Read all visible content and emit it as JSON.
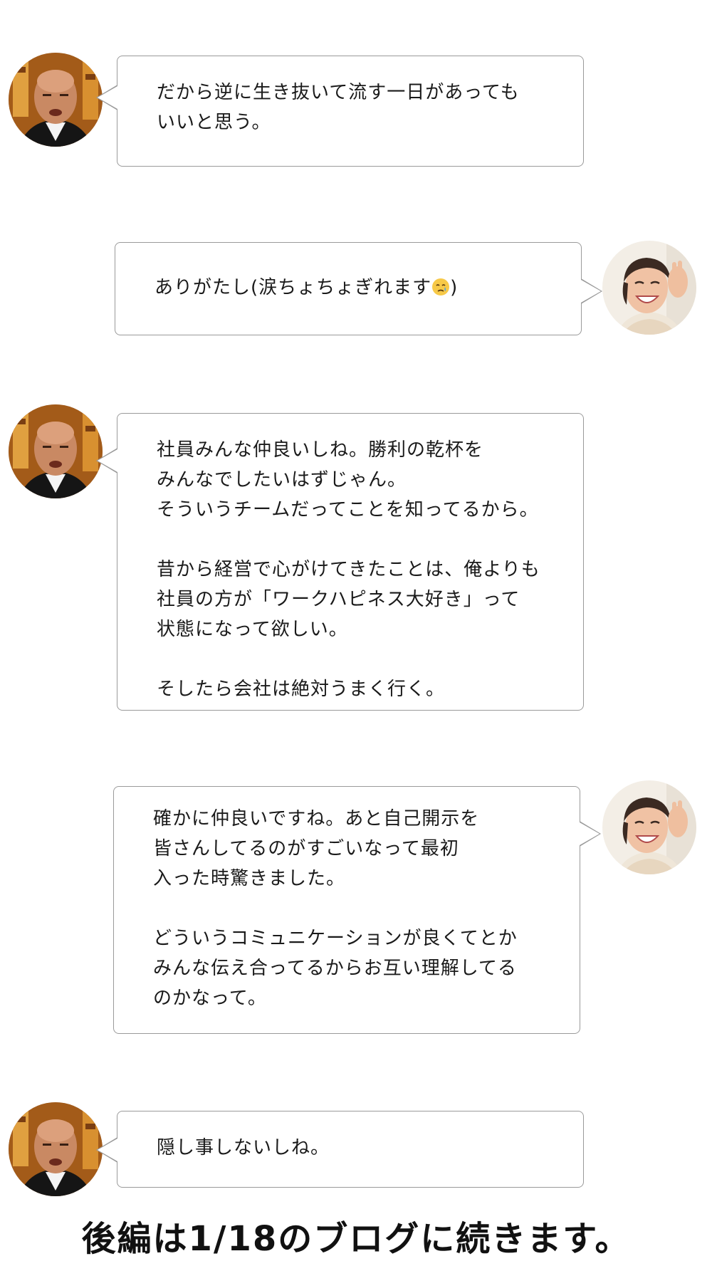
{
  "messages": [
    {
      "speaker": "man",
      "lines": [
        "だから逆に生き抜いて流す一日があっても",
        "いいと思う。"
      ]
    },
    {
      "speaker": "woman",
      "text_before_emoji": "ありがたし(涙ちょちょぎれます",
      "emoji": "crying-face-icon",
      "text_after_emoji": ")"
    },
    {
      "speaker": "man",
      "lines": [
        "社員みんな仲良いしね。勝利の乾杯を",
        "みんなでしたいはずじゃん。",
        "そういうチームだってことを知ってるから。",
        "",
        "昔から経営で心がけてきたことは、俺よりも",
        "社員の方が「ワークハピネス大好き」って",
        "状態になって欲しい。",
        "",
        "そしたら会社は絶対うまく行く。"
      ]
    },
    {
      "speaker": "woman",
      "lines": [
        "確かに仲良いですね。あと自己開示を",
        "皆さんしてるのがすごいなって最初",
        "入った時驚きました。",
        "",
        "どういうコミュニケーションが良くてとか",
        "みんな伝え合ってるからお互い理解してる",
        "のかなって。"
      ]
    },
    {
      "speaker": "man",
      "lines": [
        "隠し事しないしね。"
      ]
    }
  ],
  "footer": "後編は1/18のブログに続きます。",
  "colors": {
    "bubble_border": "#9a9a9a",
    "text": "#1a1a1a",
    "background": "#ffffff"
  }
}
